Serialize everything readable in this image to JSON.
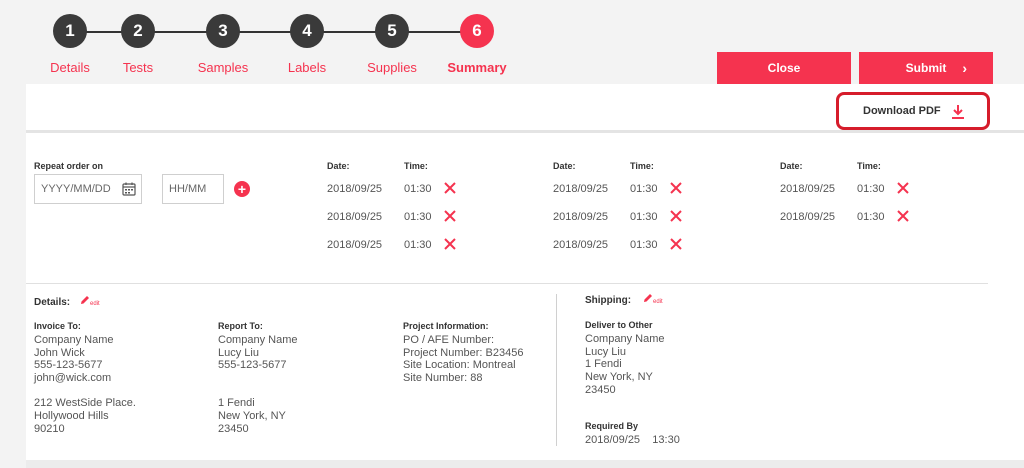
{
  "stepper": {
    "steps": [
      {
        "num": "1",
        "label": "Details"
      },
      {
        "num": "2",
        "label": "Tests"
      },
      {
        "num": "3",
        "label": "Samples"
      },
      {
        "num": "4",
        "label": "Labels"
      },
      {
        "num": "5",
        "label": "Supplies"
      },
      {
        "num": "6",
        "label": "Summary"
      }
    ],
    "active_step": "6"
  },
  "toolbar": {
    "close_label": "Close",
    "submit_label": "Submit",
    "submit_icon": "chevron-right-icon",
    "download_label": "Download PDF",
    "download_icon": "download-icon"
  },
  "repeat": {
    "label": "Repeat order on",
    "date_placeholder": "YYYY/MM/DD",
    "time_placeholder": "HH/MM",
    "add_icon": "plus-icon"
  },
  "schedule": {
    "date_header": "Date:",
    "time_header": "Time:",
    "columns": [
      {
        "rows": [
          {
            "date": "2018/09/25",
            "time": "01:30"
          },
          {
            "date": "2018/09/25",
            "time": "01:30"
          },
          {
            "date": "2018/09/25",
            "time": "01:30"
          }
        ]
      },
      {
        "rows": [
          {
            "date": "2018/09/25",
            "time": "01:30"
          },
          {
            "date": "2018/09/25",
            "time": "01:30"
          },
          {
            "date": "2018/09/25",
            "time": "01:30"
          }
        ]
      },
      {
        "rows": [
          {
            "date": "2018/09/25",
            "time": "01:30"
          },
          {
            "date": "2018/09/25",
            "time": "01:30"
          }
        ]
      }
    ]
  },
  "details": {
    "title": "Details:",
    "edit_label": "edit",
    "invoice": {
      "title": "Invoice To:",
      "company": "Company Name",
      "name": "John Wick",
      "phone": "555-123-5677",
      "email": "john@wick.com",
      "address1": "212 WestSide Place.",
      "address2": "Hollywood Hills",
      "address3": "90210"
    },
    "report": {
      "title": "Report To:",
      "company": "Company Name",
      "name": "Lucy Liu",
      "phone": "555-123-5677",
      "address1": "1 Fendi",
      "address2": "New York, NY",
      "address3": "23450"
    },
    "project": {
      "title": "Project Information:",
      "po": "PO / AFE Number:",
      "number": "Project Number: B23456",
      "site_location": "Site Location: Montreal",
      "site_number": "Site Number: 88"
    }
  },
  "shipping": {
    "title": "Shipping:",
    "edit_label": "edit",
    "deliver": {
      "title": "Deliver to Other",
      "company": "Company Name",
      "name": "Lucy Liu",
      "address1": "1 Fendi",
      "address2": "New York, NY",
      "address3": "23450"
    },
    "required_title": "Required By",
    "required_value": "2018/09/25    13:30"
  },
  "colors": {
    "accent": "#f5334f",
    "highlight_border": "#d61c2b",
    "dark_step": "#3a3a3a"
  }
}
